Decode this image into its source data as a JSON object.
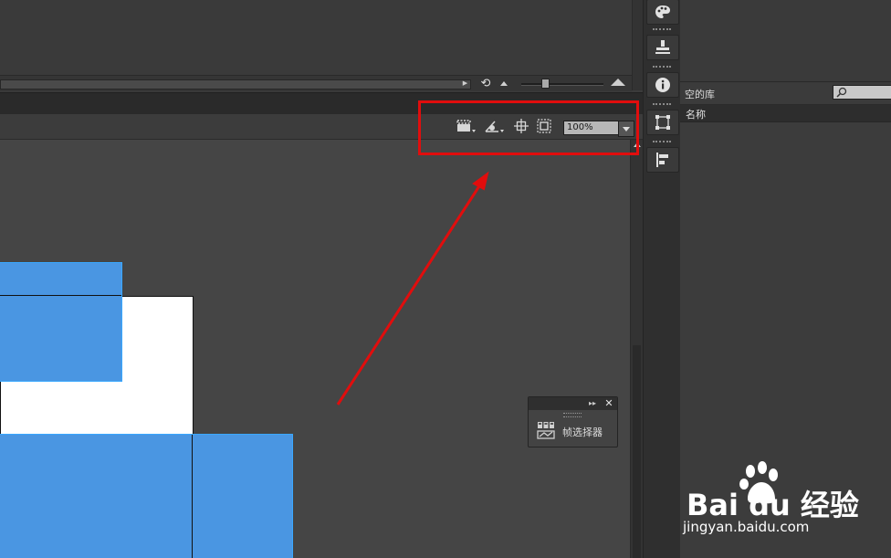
{
  "timeline": {
    "loop_icon": "loop-icon",
    "zoom_small_icon": "mountain-small-icon",
    "zoom_large_icon": "mountain-large-icon"
  },
  "edit_bar": {
    "icons": [
      "clapperboard-icon",
      "symbol-edit-icon",
      "center-stage-icon",
      "clip-canvas-icon"
    ],
    "zoom_value": "100%"
  },
  "frame_picker": {
    "label": "帧选择器",
    "icon": "frame-picker-icon"
  },
  "tools": [
    "palette-icon",
    "align-icon",
    "info-icon",
    "transform-icon",
    "distribute-icon"
  ],
  "library": {
    "title": "空的库",
    "column_name": "名称",
    "search_value": ""
  },
  "watermark": {
    "brand": "Bai du 经验",
    "url": "jingyan.baidu.com"
  },
  "colors": {
    "highlight": "#e10d0d",
    "shape_fill": "#4a96e2",
    "canvas": "#ffffff"
  }
}
